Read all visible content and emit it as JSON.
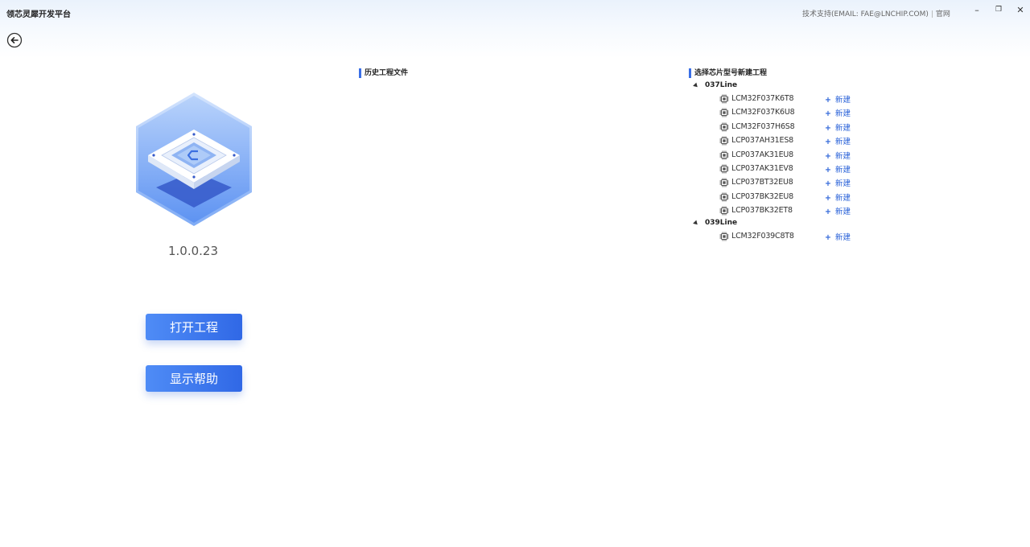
{
  "app": {
    "title": "领芯灵犀开发平台"
  },
  "header": {
    "support_label": "技术支持(EMAIL: FAE@LNCHIP.COM)",
    "website_label": "官网"
  },
  "window_controls": {
    "minimize": "–",
    "restore": "❐",
    "close": "✕"
  },
  "left": {
    "version": "1.0.0.23",
    "open_project_label": "打开工程",
    "show_help_label": "显示帮助"
  },
  "history": {
    "title": "历史工程文件"
  },
  "chips": {
    "title": "选择芯片型号新建工程",
    "new_label": "新建",
    "groups": [
      {
        "name": "037Line",
        "items": [
          "LCM32F037K6T8",
          "LCM32F037K6U8",
          "LCM32F037H6S8",
          "LCP037AH31ES8",
          "LCP037AK31EU8",
          "LCP037AK31EV8",
          "LCP037BT32EU8",
          "LCP037BK32EU8",
          "LCP037BK32ET8"
        ]
      },
      {
        "name": "039Line",
        "items": [
          "LCM32F039C8T8"
        ]
      }
    ]
  }
}
